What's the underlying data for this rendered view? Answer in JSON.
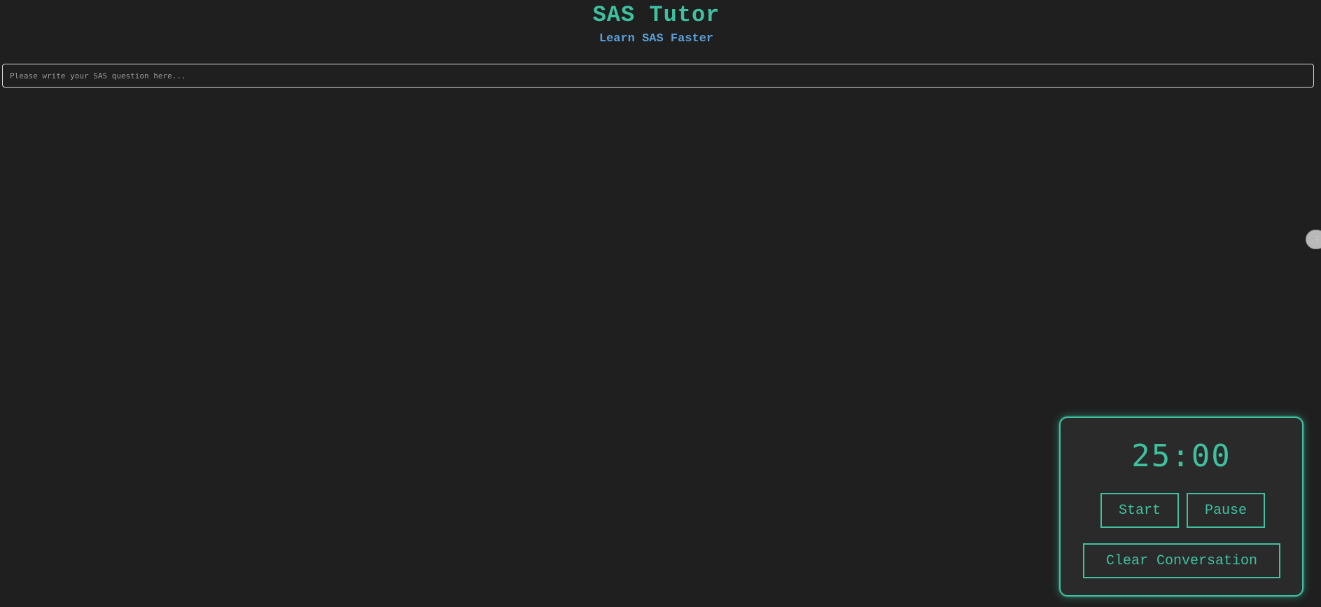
{
  "header": {
    "title": "SAS Tutor",
    "subtitle": "Learn SAS Faster"
  },
  "question": {
    "placeholder": "Please write your SAS question here...",
    "value": ""
  },
  "timer": {
    "display": "25:00",
    "start_label": "Start",
    "pause_label": "Pause",
    "clear_label": "Clear Conversation"
  },
  "colors": {
    "background": "#1f1f1f",
    "accent": "#3fc1a0",
    "subtitle": "#5b9fd6",
    "panel": "#2a2a2a"
  },
  "icons": {
    "side_handle": "drag-handle-icon"
  }
}
